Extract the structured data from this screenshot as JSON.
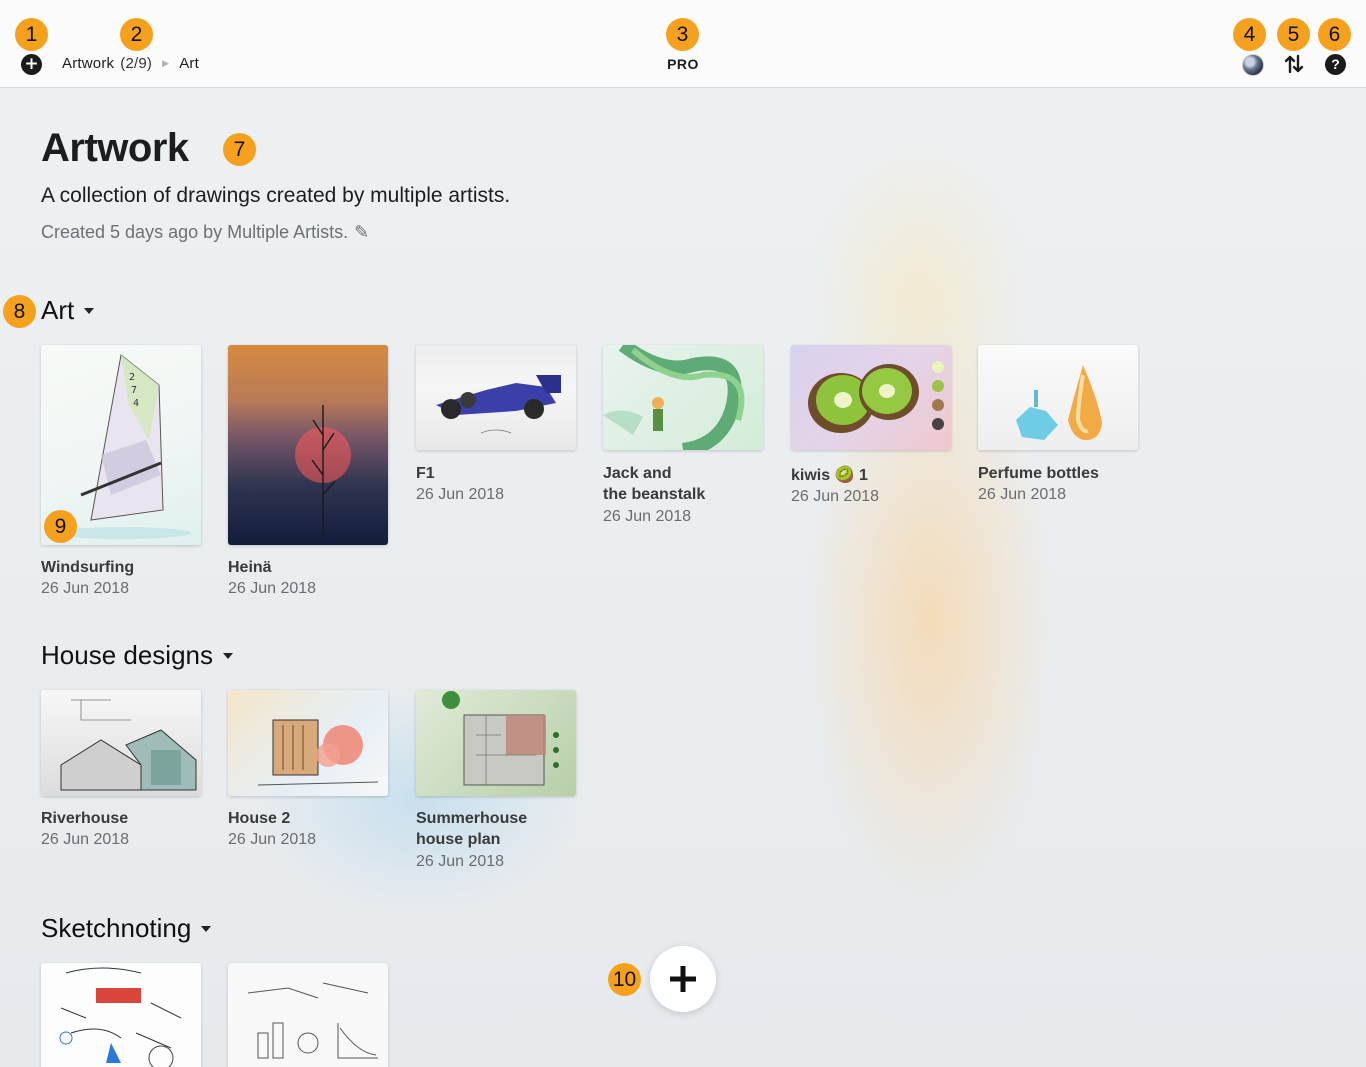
{
  "toolbar": {
    "breadcrumb": {
      "root": "Artwork",
      "count": "(2/9)",
      "current": "Art"
    },
    "center_label": "PRO",
    "help": "?"
  },
  "annotations": [
    "1",
    "2",
    "3",
    "4",
    "5",
    "6",
    "7",
    "8",
    "9",
    "10"
  ],
  "header": {
    "title": "Artwork",
    "description": "A collection of drawings created by multiple artists.",
    "meta": "Created 5 days ago by Multiple Artists.",
    "edit_glyph": "✎"
  },
  "sections": [
    {
      "title": "Art",
      "items": [
        {
          "title": "Windsurfing",
          "date": "26 Jun 2018"
        },
        {
          "title": "Heinä",
          "date": "26 Jun 2018"
        },
        {
          "title": "F1",
          "date": "26 Jun 2018"
        },
        {
          "title_line1": "Jack and",
          "title_line2": "the beanstalk",
          "date": "26 Jun 2018"
        },
        {
          "title": "kiwis 🥝 1",
          "date": "26 Jun 2018"
        },
        {
          "title": "Perfume bottles",
          "date": "26 Jun 2018"
        }
      ]
    },
    {
      "title": "House designs",
      "items": [
        {
          "title": "Riverhouse",
          "date": "26 Jun 2018"
        },
        {
          "title": "House 2",
          "date": "26 Jun 2018"
        },
        {
          "title_line1": "Summerhouse",
          "title_line2": "house plan",
          "date": "26 Jun 2018"
        }
      ]
    },
    {
      "title": "Sketchnoting",
      "items": [
        {
          "title": ""
        },
        {
          "title": ""
        }
      ]
    }
  ],
  "icons": {
    "add": "plus-circle-icon",
    "sort": "sort-arrows-icon",
    "help": "help-circle-icon",
    "fab": "plus-icon"
  },
  "colors": {
    "badge": "#f5a11d",
    "background": "#e8ecef",
    "topbar": "#fbfbfb"
  }
}
